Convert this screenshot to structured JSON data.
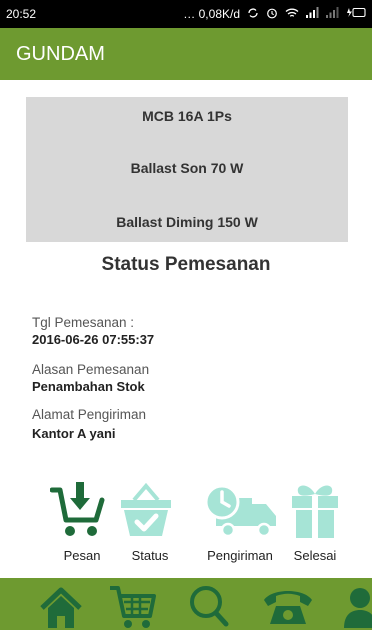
{
  "status_bar": {
    "time": "20:52",
    "network_speed": "… 0,08K/d",
    "icons": [
      "sync-icon",
      "alarm-icon",
      "wifi-icon",
      "signal-icon",
      "signal-icon",
      "battery-charging-icon"
    ]
  },
  "app_bar": {
    "title": "GUNDAM"
  },
  "order_items": [
    "MCB 16A 1Ps",
    "Ballast Son 70 W",
    "Ballast Diming 150 W"
  ],
  "status": {
    "title": "Status Pemesanan",
    "fields": [
      {
        "label": "Tgl Pemesanan :",
        "value": "2016-06-26 07:55:37"
      },
      {
        "label": "Alasan Pemesanan",
        "value": "Penambahan Stok"
      },
      {
        "label": "Alamat Pengiriman",
        "value": "Kantor A yani"
      }
    ]
  },
  "steps": [
    {
      "label": "Pesan",
      "icon": "cart-download-icon",
      "active": true
    },
    {
      "label": "Status",
      "icon": "basket-check-icon",
      "active": false
    },
    {
      "label": "Pengiriman",
      "icon": "delivery-truck-icon",
      "active": false
    },
    {
      "label": "Selesai",
      "icon": "gift-icon",
      "active": false
    }
  ],
  "bottom_nav": [
    "home-icon",
    "cart-icon",
    "search-icon",
    "phone-icon",
    "profile-icon"
  ],
  "colors": {
    "primary": "#6e9a30",
    "active_step": "#1f6b3a",
    "inactive_step": "#a6e4d6",
    "list_bg": "#d8d8d8"
  }
}
